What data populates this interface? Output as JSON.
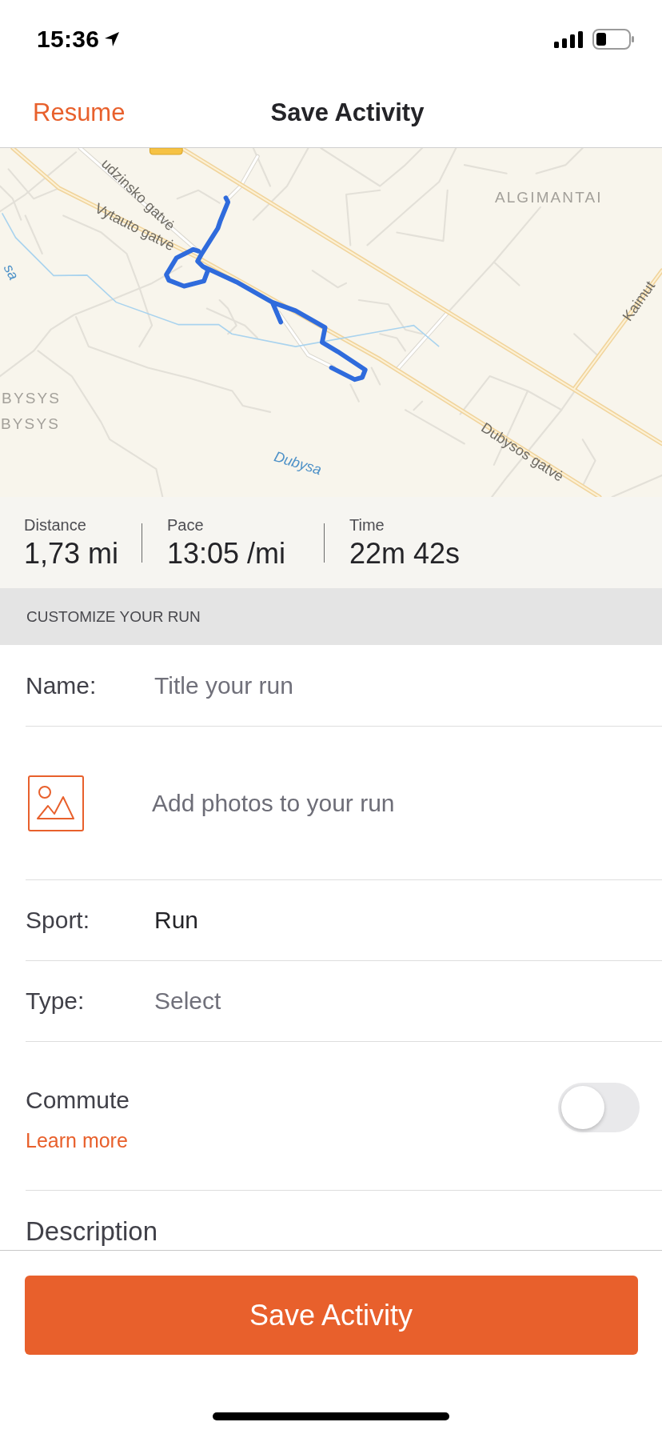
{
  "status_bar": {
    "time": "15:36"
  },
  "nav": {
    "back": "Resume",
    "title": "Save Activity"
  },
  "map": {
    "labels": [
      {
        "kind": "street",
        "text": "udzinsko gatvė"
      },
      {
        "kind": "district",
        "text": "ALGIMANTAI"
      },
      {
        "kind": "street",
        "text": "Vytauto gatvė"
      },
      {
        "kind": "river",
        "text": "sa"
      },
      {
        "kind": "street",
        "text": "Kaimut"
      },
      {
        "kind": "district",
        "text": "BYSYS"
      },
      {
        "kind": "district",
        "text": "BYSYS"
      },
      {
        "kind": "street",
        "text": "Dubysos gatvė"
      },
      {
        "kind": "river",
        "text": "Dubysa"
      }
    ]
  },
  "stats": [
    {
      "label": "Distance",
      "value": "1,73 mi"
    },
    {
      "label": "Pace",
      "value": "13:05 /mi"
    },
    {
      "label": "Time",
      "value": "22m 42s"
    }
  ],
  "section_header": "CUSTOMIZE YOUR RUN",
  "form": {
    "rows": [
      {
        "kind": "text",
        "label": "Name:",
        "placeholder": "Title your run"
      },
      {
        "kind": "photos",
        "text": "Add photos to your run"
      },
      {
        "kind": "select",
        "label": "Sport:",
        "value": "Run"
      },
      {
        "kind": "select",
        "label": "Type:",
        "placeholder": "Select"
      },
      {
        "kind": "toggle",
        "label": "Commute",
        "link": "Learn more",
        "on": false
      },
      {
        "kind": "label",
        "label": "Description"
      }
    ]
  },
  "primary_button": "Save Activity"
}
